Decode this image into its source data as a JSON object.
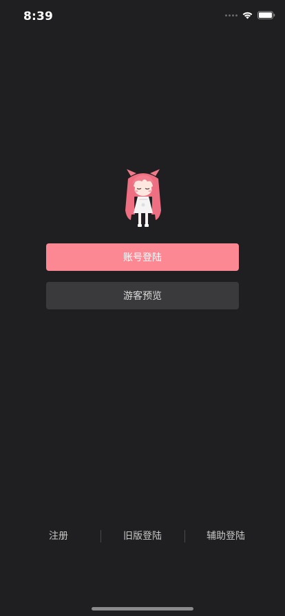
{
  "status_bar": {
    "time": "8:39",
    "icons": [
      "cellular-signal-icon",
      "wifi-icon",
      "battery-icon"
    ]
  },
  "mascot": {
    "icon": "anime-girl-mascot"
  },
  "buttons": {
    "login_label": "账号登陆",
    "guest_label": "游客预览"
  },
  "bottom_links": {
    "register": "注册",
    "old_login": "旧版登陆",
    "assist_login": "辅助登陆"
  },
  "colors": {
    "background": "#1f1f21",
    "login_button": "#fc8894",
    "guest_button": "#3a3a3d",
    "link_text": "#c8c8c8"
  }
}
